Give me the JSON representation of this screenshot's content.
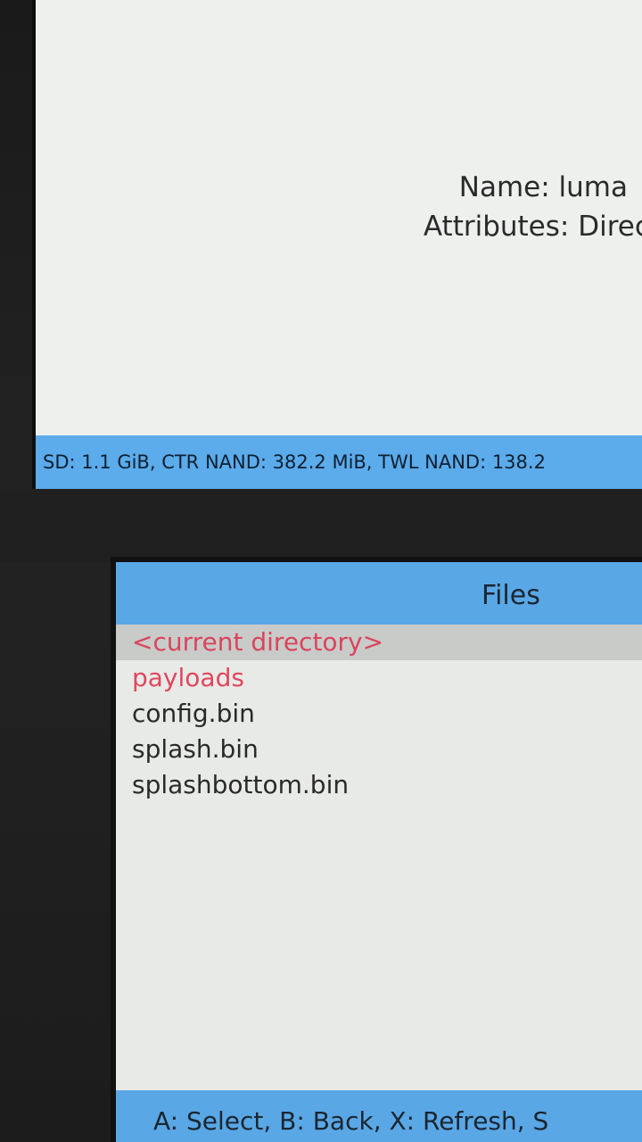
{
  "top_screen": {
    "name_line": "Name: luma",
    "attributes_line": "Attributes: Directo",
    "status_bar": "SD: 1.1 GiB, CTR NAND: 382.2 MiB, TWL NAND: 138.2"
  },
  "bottom_screen": {
    "header_title": "Files",
    "files": [
      {
        "label": "<current directory>",
        "type": "selected"
      },
      {
        "label": "payloads",
        "type": "dir"
      },
      {
        "label": "config.bin",
        "type": "file"
      },
      {
        "label": "splash.bin",
        "type": "file"
      },
      {
        "label": "splashbottom.bin",
        "type": "file"
      }
    ],
    "hint_bar": "A: Select, B: Back, X: Refresh, S"
  },
  "colors": {
    "bar_blue": "#5aa7e6",
    "dir_red": "#e0465e",
    "screen_bg": "#eef0ee"
  }
}
